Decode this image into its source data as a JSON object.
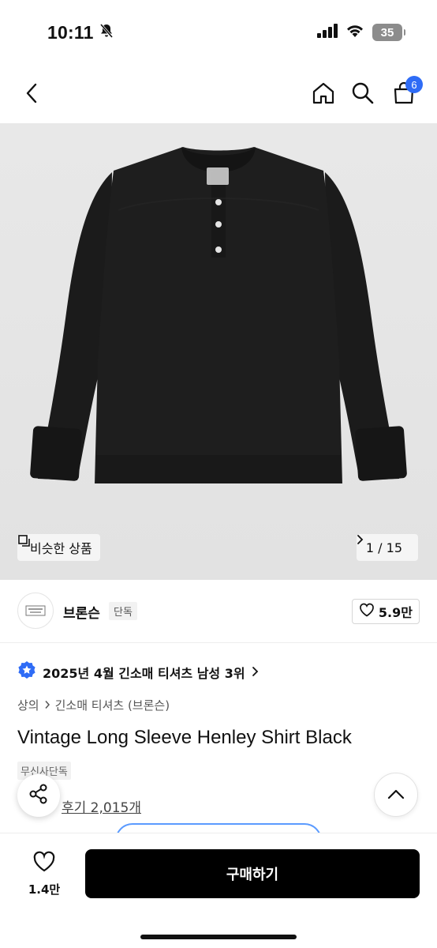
{
  "status_bar": {
    "time": "10:11",
    "battery": "35"
  },
  "nav": {
    "cart_count": "6"
  },
  "gallery": {
    "similar_label": "비슷한 상품",
    "page_counter": "1 / 15"
  },
  "brand": {
    "name": "브론슨",
    "tag": "단독",
    "likes": "5.9만"
  },
  "ranking": {
    "text": "2025년 4월 긴소매 티셔츠 남성 3위"
  },
  "breadcrumb": {
    "category": "상의",
    "subcategory": "긴소매 티셔츠 (브론슨)"
  },
  "product": {
    "title": "Vintage Long Sleeve Henley Shirt Black",
    "exclusive_tag": "무신사단독",
    "reviews": "후기 2,015개"
  },
  "bottom_bar": {
    "wish_count": "1.4만",
    "buy_label": "구매하기"
  },
  "colors": {
    "accent": "#2f6cf6",
    "shirt": "#1c1c1c",
    "buy_button": "#000000"
  }
}
